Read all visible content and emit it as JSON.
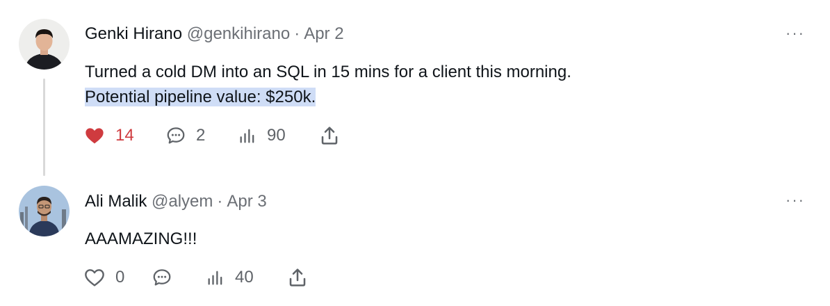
{
  "posts": [
    {
      "author_name": "Genki Hirano",
      "handle": "@genkihirano",
      "separator": "·",
      "date": "Apr 2",
      "more_label": "···",
      "body_line_1": "Turned a cold DM into an SQL in 15 mins for a client this morning.",
      "body_line_2": "Potential pipeline value: $250k.",
      "likes": "14",
      "liked": true,
      "replies": "2",
      "views": "90"
    },
    {
      "author_name": "Ali Malik",
      "handle": "@alyem",
      "separator": "·",
      "date": "Apr 3",
      "more_label": "···",
      "body_line_1": "AAAMAZING!!!",
      "likes": "0",
      "liked": false,
      "replies": "",
      "views": "40"
    }
  ],
  "colors": {
    "like_active": "#cf3b3f",
    "muted": "#6b6f75",
    "selection": "#cfddf6",
    "thread_line": "#d9d9d9"
  }
}
